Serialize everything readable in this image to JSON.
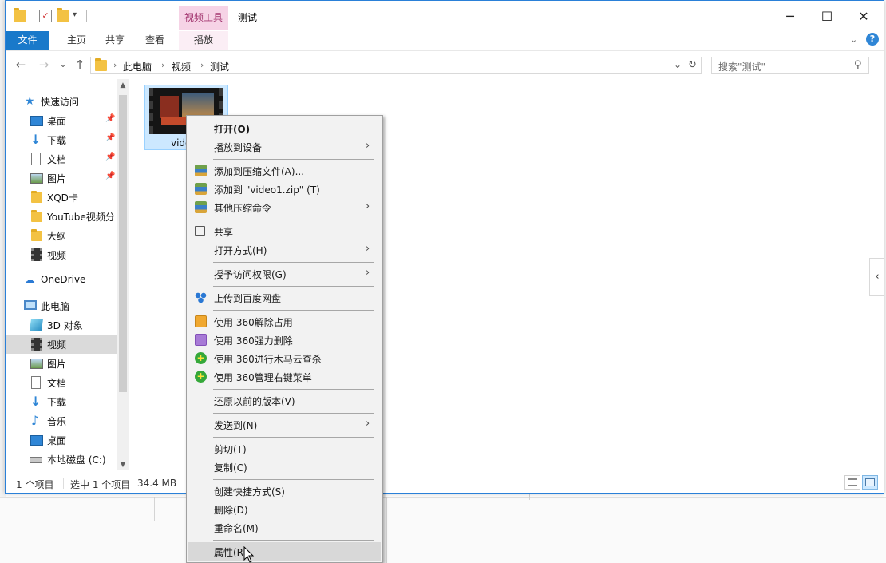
{
  "window": {
    "title": "测试",
    "context_tab_group": "视频工具",
    "controls": {
      "minimize": "─",
      "maximize": "☐",
      "close": "✕"
    }
  },
  "ribbon": {
    "tabs": [
      "文件",
      "主页",
      "共享",
      "查看",
      "播放"
    ],
    "help_label": "?"
  },
  "navigation": {
    "back": "←",
    "forward": "→",
    "recent": "⌄",
    "up": "↑",
    "breadcrumb": [
      "此电脑",
      "视频",
      "测试"
    ],
    "breadcrumb_sep": "›",
    "search_placeholder": "搜索\"测试\""
  },
  "sidebar": {
    "quick_access": "快速访问",
    "quick_items": [
      {
        "label": "桌面",
        "icon": "desktop-icon",
        "pinned": true
      },
      {
        "label": "下载",
        "icon": "download-icon",
        "pinned": true
      },
      {
        "label": "文档",
        "icon": "document-icon",
        "pinned": true
      },
      {
        "label": "图片",
        "icon": "picture-icon",
        "pinned": true
      },
      {
        "label": "XQD卡",
        "icon": "folder-icon",
        "pinned": false
      },
      {
        "label": "YouTube视频分",
        "icon": "folder-icon",
        "pinned": false
      },
      {
        "label": "大纲",
        "icon": "folder-icon",
        "pinned": false
      },
      {
        "label": "视频",
        "icon": "video-folder-icon",
        "pinned": false
      }
    ],
    "onedrive": "OneDrive",
    "this_pc": "此电脑",
    "pc_items": [
      {
        "label": "3D 对象",
        "icon": "3d-objects-icon"
      },
      {
        "label": "视频",
        "icon": "video-folder-icon",
        "selected": true
      },
      {
        "label": "图片",
        "icon": "picture-icon"
      },
      {
        "label": "文档",
        "icon": "document-icon"
      },
      {
        "label": "下载",
        "icon": "download-icon"
      },
      {
        "label": "音乐",
        "icon": "music-icon"
      },
      {
        "label": "桌面",
        "icon": "desktop-icon"
      },
      {
        "label": "本地磁盘 (C:)",
        "icon": "drive-icon"
      }
    ]
  },
  "content": {
    "file_label": "vide"
  },
  "status": {
    "item_count": "1 个项目",
    "selected": "选中 1 个项目",
    "size": "34.4 MB"
  },
  "context_menu": {
    "items": [
      {
        "label": "打开(O)",
        "bold": true
      },
      {
        "label": "播放到设备",
        "submenu": true
      },
      {
        "sep": true
      },
      {
        "label": "添加到压缩文件(A)...",
        "icon": "archive-icon"
      },
      {
        "label": "添加到 \"video1.zip\" (T)",
        "icon": "archive-icon"
      },
      {
        "label": "其他压缩命令",
        "icon": "archive-icon",
        "submenu": true
      },
      {
        "sep": true
      },
      {
        "label": "共享",
        "icon": "share-icon"
      },
      {
        "label": "打开方式(H)",
        "submenu": true
      },
      {
        "sep": true
      },
      {
        "label": "授予访问权限(G)",
        "submenu": true
      },
      {
        "sep": true
      },
      {
        "label": "上传到百度网盘",
        "icon": "baidu-netdisk-icon"
      },
      {
        "sep": true
      },
      {
        "label": "使用 360解除占用",
        "icon": "360-unlock-icon"
      },
      {
        "label": "使用 360强力删除",
        "icon": "360-delete-icon"
      },
      {
        "label": "使用 360进行木马云查杀",
        "icon": "360-scan-icon"
      },
      {
        "label": "使用 360管理右键菜单",
        "icon": "360-menu-icon"
      },
      {
        "sep": true
      },
      {
        "label": "还原以前的版本(V)"
      },
      {
        "sep": true
      },
      {
        "label": "发送到(N)",
        "submenu": true
      },
      {
        "sep": true
      },
      {
        "label": "剪切(T)"
      },
      {
        "label": "复制(C)"
      },
      {
        "sep": true
      },
      {
        "label": "创建快捷方式(S)"
      },
      {
        "label": "删除(D)"
      },
      {
        "label": "重命名(M)"
      },
      {
        "sep": true
      },
      {
        "label": "属性(R)",
        "hover": true
      }
    ]
  }
}
